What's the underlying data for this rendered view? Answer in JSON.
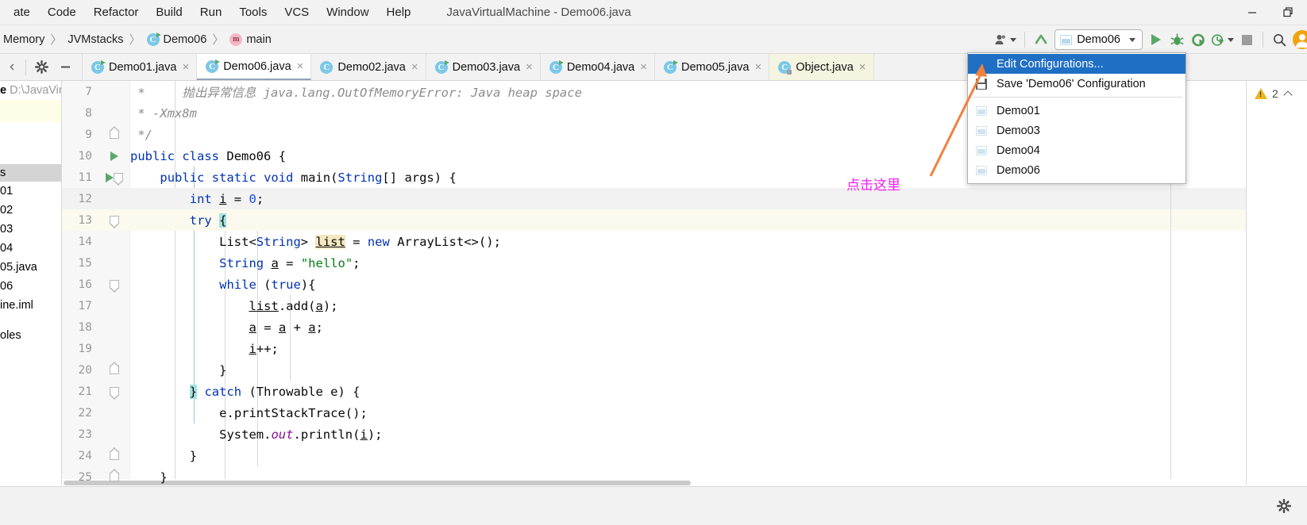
{
  "titlebar": {
    "menus": [
      "ate",
      "Code",
      "Refactor",
      "Build",
      "Run",
      "Tools",
      "VCS",
      "Window",
      "Help"
    ],
    "window_title": "JavaVirtualMachine - Demo06.java",
    "minimize_label": "minimize",
    "restore_label": "restore"
  },
  "breadcrumb": {
    "items": [
      {
        "label": "Memory",
        "icon": "none"
      },
      {
        "label": "JVMstacks",
        "icon": "none"
      },
      {
        "label": "Demo06",
        "icon": "class-icon"
      },
      {
        "label": "main",
        "icon": "method-icon"
      }
    ],
    "separator": "〉"
  },
  "toolbar": {
    "user_icon": "user-icon",
    "updates_icon": "update-arrow-icon",
    "run_config_name": "Demo06",
    "run_label": "run-icon",
    "debug_label": "debug-icon",
    "coverage_label": "run-with-coverage-icon",
    "profile_label": "profile-icon",
    "stop_label": "stop-icon",
    "search_label": "search-icon",
    "avatar_label": "account-avatar"
  },
  "run_config_dropdown": {
    "items": [
      {
        "label": "Edit Configurations...",
        "icon": "none",
        "selected": true
      },
      {
        "label": "Save 'Demo06' Configuration",
        "icon": "save-icon",
        "selected": false
      }
    ],
    "configs": [
      {
        "label": "Demo01",
        "icon": "application-config-icon"
      },
      {
        "label": "Demo03",
        "icon": "application-config-icon"
      },
      {
        "label": "Demo04",
        "icon": "application-config-icon"
      },
      {
        "label": "Demo06",
        "icon": "application-config-icon"
      }
    ]
  },
  "tabs": {
    "tools": [
      "gear-icon",
      "minimize-icon"
    ],
    "items": [
      {
        "label": "Demo01.java",
        "icon": "class-runnable-icon",
        "active": false,
        "readonly": false
      },
      {
        "label": "Demo06.java",
        "icon": "class-runnable-icon",
        "active": true,
        "readonly": false
      },
      {
        "label": "Demo02.java",
        "icon": "class-icon",
        "active": false,
        "readonly": false
      },
      {
        "label": "Demo03.java",
        "icon": "class-runnable-icon",
        "active": false,
        "readonly": false
      },
      {
        "label": "Demo04.java",
        "icon": "class-runnable-icon",
        "active": false,
        "readonly": false
      },
      {
        "label": "Demo05.java",
        "icon": "class-runnable-icon",
        "active": false,
        "readonly": false
      },
      {
        "label": "Object.java",
        "icon": "class-locked-icon",
        "active": false,
        "readonly": true
      }
    ],
    "close_glyph": "×"
  },
  "project_panel": {
    "header_bold": "e",
    "header_path": "D:\\JavaVir",
    "selected_row": "s",
    "rows": [
      "01",
      "02",
      "03",
      "04",
      "05.java",
      "06",
      "ine.iml"
    ],
    "footer_row": "oles"
  },
  "editor": {
    "lines": [
      {
        "num": "7",
        "fold": "none",
        "run": false,
        "hl": "none"
      },
      {
        "num": "8",
        "fold": "none",
        "run": false,
        "hl": "none"
      },
      {
        "num": "9",
        "fold": "up",
        "run": false,
        "hl": "none"
      },
      {
        "num": "10",
        "fold": "none",
        "run": true,
        "hl": "none"
      },
      {
        "num": "11",
        "fold": "down",
        "run": true,
        "hl": "none"
      },
      {
        "num": "12",
        "fold": "none",
        "run": false,
        "hl": "gray"
      },
      {
        "num": "13",
        "fold": "down",
        "run": false,
        "hl": "caret"
      },
      {
        "num": "14",
        "fold": "none",
        "run": false,
        "hl": "none"
      },
      {
        "num": "15",
        "fold": "none",
        "run": false,
        "hl": "none"
      },
      {
        "num": "16",
        "fold": "down",
        "run": false,
        "hl": "none"
      },
      {
        "num": "17",
        "fold": "none",
        "run": false,
        "hl": "none"
      },
      {
        "num": "18",
        "fold": "none",
        "run": false,
        "hl": "none"
      },
      {
        "num": "19",
        "fold": "none",
        "run": false,
        "hl": "none"
      },
      {
        "num": "20",
        "fold": "up",
        "run": false,
        "hl": "none"
      },
      {
        "num": "21",
        "fold": "down",
        "run": false,
        "hl": "none"
      },
      {
        "num": "22",
        "fold": "none",
        "run": false,
        "hl": "none"
      },
      {
        "num": "23",
        "fold": "none",
        "run": false,
        "hl": "none"
      },
      {
        "num": "24",
        "fold": "up",
        "run": false,
        "hl": "none"
      },
      {
        "num": "25",
        "fold": "up",
        "run": false,
        "hl": "none"
      }
    ],
    "source_text": [
      " *     抛出异常信息 java.lang.OutOfMemoryError: Java heap space",
      " * -Xmx8m",
      " */",
      "public class Demo06 {",
      "    public static void main(String[] args) {",
      "        int i = 0;",
      "        try {",
      "            List<String> list = new ArrayList<>();",
      "            String a = \"hello\";",
      "            while (true){",
      "                list.add(a);",
      "                a = a + a;",
      "                i++;",
      "            }",
      "        } catch (Throwable e) {",
      "            e.printStackTrace();",
      "            System.out.println(i);",
      "        }",
      "    }"
    ]
  },
  "inspections": {
    "warning_count": "2",
    "warning_icon": "warning-triangle-icon",
    "collapse_icon": "chevron-up-icon"
  },
  "annotation": {
    "text": "点击这里",
    "arrow_color": "#f2813c",
    "text_color": "#f41ef4"
  },
  "statusbar": {
    "settings_icon": "gear-icon"
  },
  "colors": {
    "accent_blue": "#1f6fc4",
    "run_green": "#59a869",
    "warning_yellow": "#ecb61e",
    "keyword_blue": "#0033b3",
    "string_green": "#067d17",
    "field_purple": "#871094",
    "ident_highlight": "#f5e8c0",
    "brace_highlight": "#a3e3e0",
    "caret_line": "#fcfaef"
  }
}
